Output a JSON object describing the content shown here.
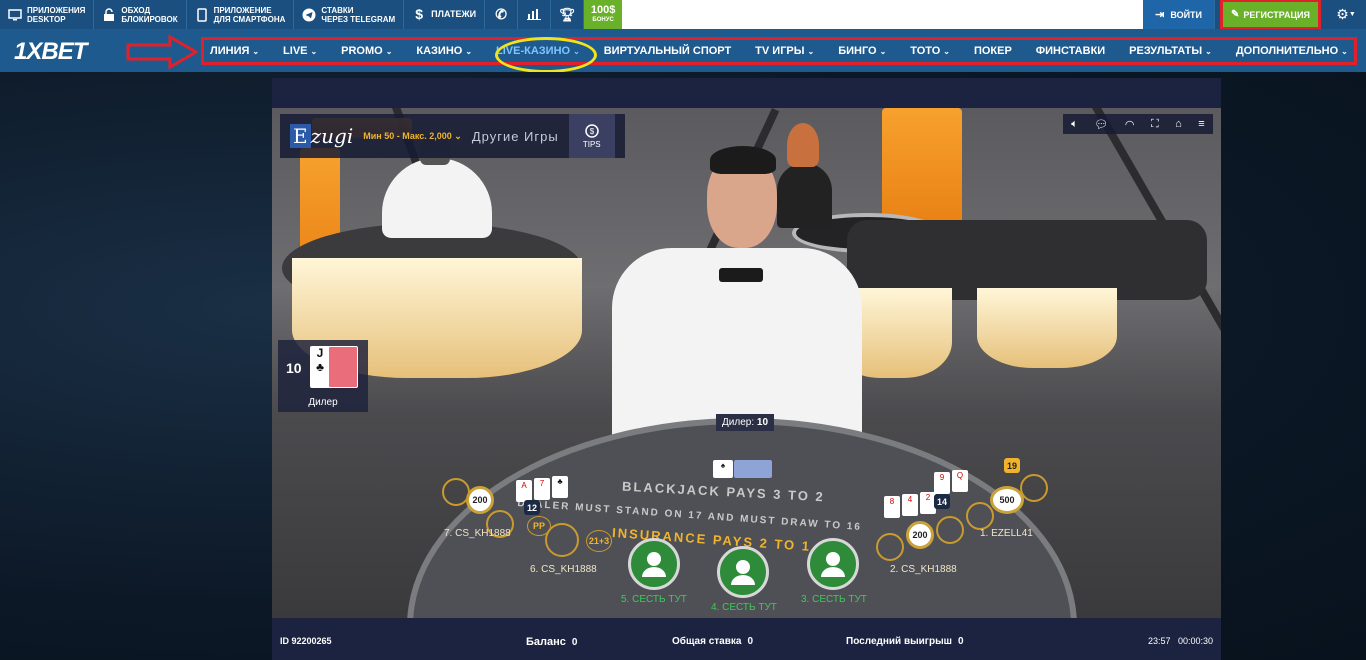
{
  "topbar": {
    "items": [
      {
        "icon": "desktop-icon",
        "line1": "ПРИЛОЖЕНИЯ",
        "line2": "DESKTOP"
      },
      {
        "icon": "lock-icon",
        "line1": "ОБХОД",
        "line2": "БЛОКИРОВОК"
      },
      {
        "icon": "smartphone-icon",
        "line1": "ПРИЛОЖЕНИЕ",
        "line2": "ДЛЯ СМАРТФОНА"
      },
      {
        "icon": "telegram-icon",
        "line1": "СТАВКИ",
        "line2": "ЧЕРЕЗ TELEGRAM"
      },
      {
        "icon": "dollar-icon",
        "line1": "ПЛАТЕЖИ",
        "line2": ""
      }
    ],
    "bonus_amount": "100$",
    "bonus_label": "БОНУС",
    "login_label": "ВОЙТИ",
    "register_label": "РЕГИСТРАЦИЯ"
  },
  "logo": "1XBET",
  "nav": {
    "items": [
      {
        "label": "ЛИНИЯ",
        "chevron": true
      },
      {
        "label": "LIVE",
        "chevron": true
      },
      {
        "label": "PROMO",
        "chevron": true
      },
      {
        "label": "КАЗИНО",
        "chevron": true
      },
      {
        "label": "LIVE-КАЗИНО",
        "chevron": true,
        "active": true
      },
      {
        "label": "ВИРТУАЛЬНЫЙ СПОРТ",
        "chevron": false
      },
      {
        "label": "TV ИГРЫ",
        "chevron": true
      },
      {
        "label": "БИНГО",
        "chevron": true
      },
      {
        "label": "ТОТО",
        "chevron": true
      },
      {
        "label": "ПОКЕР",
        "chevron": false
      },
      {
        "label": "ФИНСТАВКИ",
        "chevron": false
      },
      {
        "label": "РЕЗУЛЬТАТЫ",
        "chevron": true
      },
      {
        "label": "ДОПОЛНИТЕЛЬНО",
        "chevron": true
      }
    ]
  },
  "game": {
    "provider": "zugi",
    "provider_initial": "E",
    "limits": "Мин 50 - Макс. 2,000",
    "other_games": "Другие Игры",
    "tips_label": "TIPS",
    "dealer_score": "10",
    "dealer_card": "J",
    "dealer_label": "Дилер",
    "dealer_tip_label": "Дилер:",
    "dealer_tip_value": "10",
    "felt_line1": "BLACKJACK PAYS 3 TO 2",
    "felt_line2": "DEALER MUST STAND ON 17 AND MUST DRAW TO 16",
    "felt_line3": "INSURANCE PAYS 2 TO 1",
    "seats": [
      {
        "label": "7. CS_KH1888",
        "chip": "200",
        "score": "12"
      },
      {
        "label": "6. CS_KH1888"
      },
      {
        "label": "2. CS_KH1888",
        "chip": "200",
        "score": "14"
      },
      {
        "label": "1. EZELL41",
        "chip": "500",
        "score": "19"
      }
    ],
    "sit_seats": [
      {
        "label": "5. СЕСТЬ ТУТ"
      },
      {
        "label": "4. СЕСТЬ ТУТ"
      },
      {
        "label": "3. СЕСТЬ ТУТ"
      }
    ],
    "side_bets": [
      "PP",
      "21+3"
    ]
  },
  "status": {
    "id": "ID 92200265",
    "balance_label": "Баланс",
    "balance_value": "0",
    "total_bet_label": "Общая ставка",
    "total_bet_value": "0",
    "last_win_label": "Последний выигрыш",
    "last_win_value": "0",
    "clock": "23:57",
    "timer": "00:00:30"
  },
  "colors": {
    "topbar": "#1a4f7f",
    "navbar": "#1f5a8e",
    "register": "#6ab12a",
    "annotation_red": "#e0202a",
    "annotation_yellow": "#f3e31a",
    "sit_green": "#3ec95a"
  }
}
